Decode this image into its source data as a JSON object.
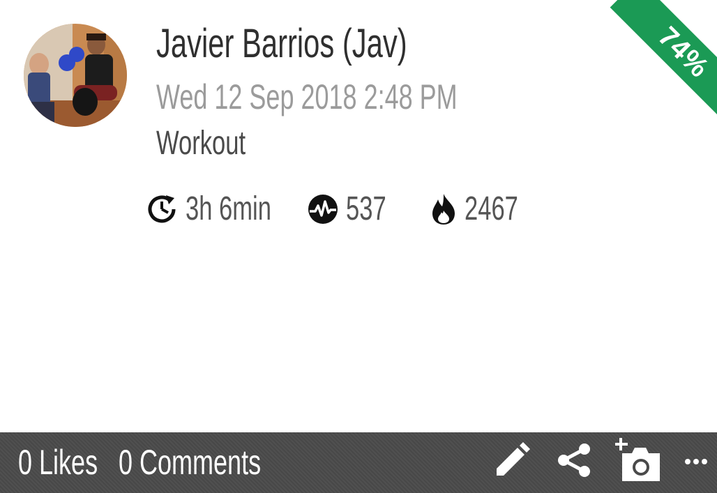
{
  "post": {
    "user_name": "Javier Barrios (Jav)",
    "date": "Wed 12 Sep 2018 2:48 PM",
    "activity_type": "Workout",
    "badge_percent": "74%",
    "badge_color": "#1b9a55"
  },
  "stats": {
    "duration": {
      "icon": "duration-clock-icon",
      "value": "3h 6min"
    },
    "heart_rate": {
      "icon": "heart-rate-icon",
      "value": "537"
    },
    "calories": {
      "icon": "flame-icon",
      "value": "2467"
    }
  },
  "footer": {
    "likes": "0 Likes",
    "comments": "0 Comments",
    "actions": [
      "pencil-icon",
      "share-icon",
      "add-photo-icon",
      "more-icon"
    ]
  }
}
